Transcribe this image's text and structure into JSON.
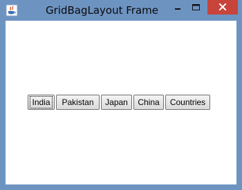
{
  "window": {
    "title": "GridBagLayout Frame",
    "controls": {
      "minimize_icon": "minimize-icon",
      "maximize_icon": "maximize-icon",
      "close_icon": "close-icon"
    },
    "app_icon": "java-icon"
  },
  "buttons": [
    {
      "label": "India",
      "focused": true
    },
    {
      "label": "Pakistan"
    },
    {
      "label": "Japan"
    },
    {
      "label": "China"
    },
    {
      "label": "Countries"
    }
  ],
  "colors": {
    "titlebar": "#6d93c1",
    "close_button": "#c7443b",
    "content_bg": "#ffffff"
  }
}
